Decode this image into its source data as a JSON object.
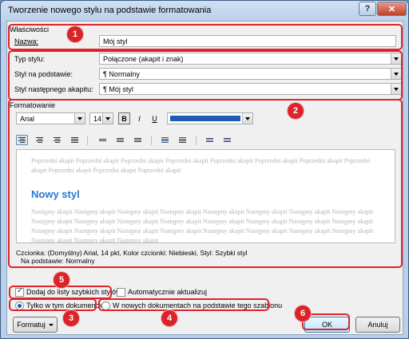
{
  "window": {
    "title": "Tworzenie nowego stylu na podstawie formatowania"
  },
  "properties": {
    "group_label": "Właściwości",
    "name_label": "Nazwa:",
    "name_value": "Mój styl",
    "style_type_label": "Typ stylu:",
    "style_type_value": "Połączone (akapit i znak)",
    "based_on_label": "Styl na podstawie:",
    "based_on_value": "¶  Normalny",
    "next_style_label": "Styl następnego akapitu:",
    "next_style_value": "¶  Mój styl"
  },
  "formatting": {
    "group_label": "Formatowanie",
    "font": "Arial",
    "size": "14",
    "bold": "B",
    "italic": "I",
    "underline": "U",
    "color": "#1f5ab7"
  },
  "preview": {
    "previous_paragraph": "Poprzedni akapit Poprzedni akapit Poprzedni akapit Poprzedni akapit Poprzedni akapit Poprzedni akapit Poprzedni akapit Poprzedni akapit Poprzedni akapit Poprzedni akapit Poprzedni akapit",
    "sample": "Nowy styl",
    "next_paragraph": "Następny akapit Następny akapit Następny akapit Następny akapit Następny akapit Następny akapit Następny akapit Następny akapit Następny akapit Następny akapit Następny akapit Następny akapit Następny akapit Następny akapit Następny akapit Następny akapit Następny akapit Następny akapit Następny akapit Następny akapit Następny akapit Następny akapit Następny akapit Następny akapit Następny akapit Następny akapit Następny akapit"
  },
  "description": {
    "line1": "Czcionka: (Domyślny) Arial, 14 pkt, Kolor czcionki: Niebieski, Styl: Szybki styl",
    "line2": "Na podstawie: Normalny"
  },
  "options": {
    "add_quick_styles": "Dodaj do listy szybkich stylów",
    "auto_update": "Automatycznie aktualizuj",
    "only_this_doc": "Tylko w tym dokumencie",
    "new_docs": "W nowych dokumentach na podstawie tego szablonu"
  },
  "buttons": {
    "format": "Formatuj",
    "ok": "OK",
    "cancel": "Anuluj"
  },
  "title_buttons": {
    "help": "?",
    "close": "✕"
  },
  "callouts": [
    "1",
    "2",
    "3",
    "4",
    "5",
    "6"
  ],
  "colors": {
    "highlight": "#e0232b",
    "badge": "#d9242a",
    "preview_heading": "#2a76d4"
  }
}
